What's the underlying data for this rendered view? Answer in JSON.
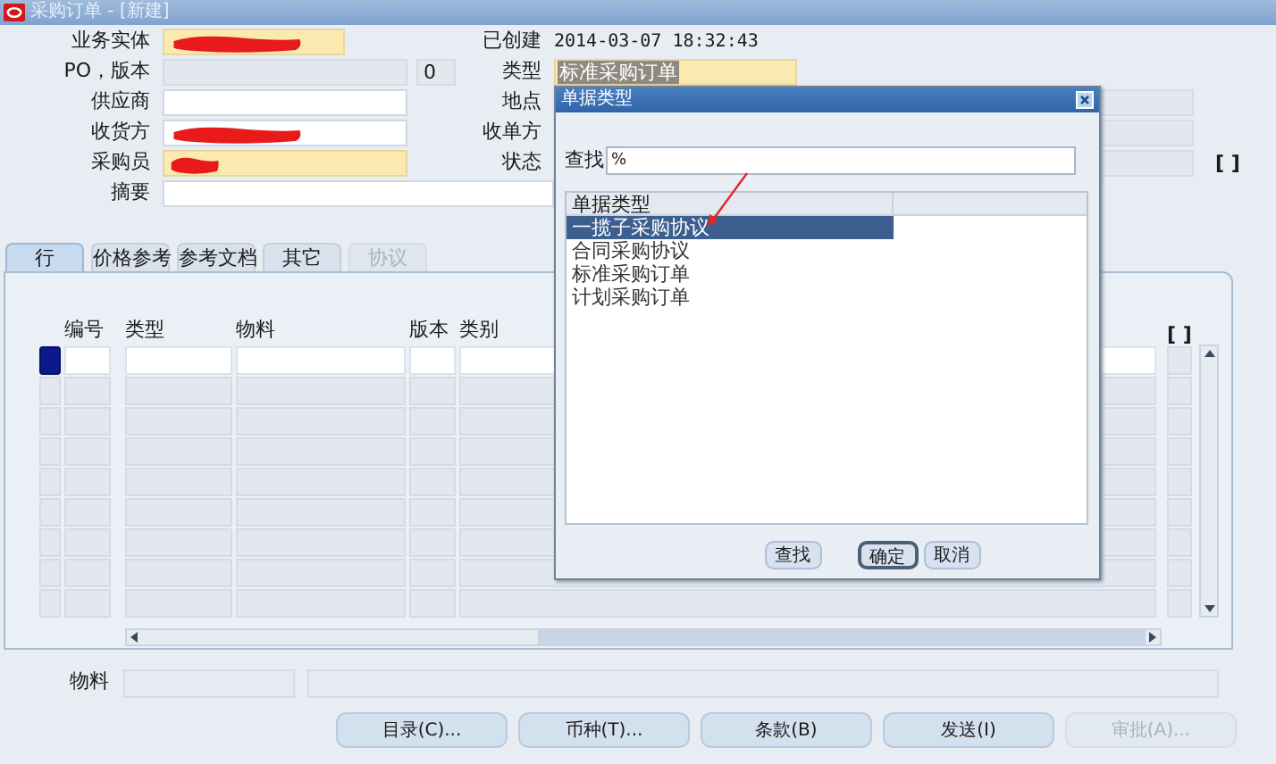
{
  "window": {
    "title": "采购订单 - [新建]"
  },
  "left_fields": [
    {
      "label": "业务实体",
      "required": true,
      "redacted": true,
      "readonly": false
    },
    {
      "label": "PO，版本",
      "required": false,
      "redacted": false,
      "readonly": true,
      "extra_value": "0"
    },
    {
      "label": "供应商",
      "required": false,
      "redacted": false,
      "readonly": false
    },
    {
      "label": "收货方",
      "required": false,
      "redacted": true,
      "readonly": false
    },
    {
      "label": "采购员",
      "required": true,
      "redacted": true,
      "readonly": false
    },
    {
      "label": "摘要",
      "required": false,
      "redacted": false,
      "readonly": false
    }
  ],
  "right_fields": [
    {
      "label": "已创建",
      "kind": "text",
      "value": "2014-03-07 18:32:43"
    },
    {
      "label": "类型",
      "kind": "field",
      "value": "标准采购订单",
      "required": true
    },
    {
      "label": "地点",
      "kind": "field",
      "required": false
    },
    {
      "label": "收单方",
      "kind": "field",
      "required": false
    },
    {
      "label": "状态",
      "kind": "field",
      "required": false,
      "marker": "[ ]"
    }
  ],
  "tabs": [
    {
      "label": "行",
      "selected": true,
      "disabled": false
    },
    {
      "label": "价格参考",
      "selected": false,
      "disabled": false
    },
    {
      "label": "参考文档",
      "selected": false,
      "disabled": false
    },
    {
      "label": "其它",
      "selected": false,
      "disabled": false
    },
    {
      "label": "协议",
      "selected": false,
      "disabled": true
    }
  ],
  "lines": {
    "columns": [
      "编号",
      "类型",
      "物料",
      "版本",
      "类别"
    ],
    "marker": "[ ]",
    "rows": [
      {
        "current": true
      },
      {
        "current": false
      },
      {
        "current": false
      },
      {
        "current": false
      },
      {
        "current": false
      },
      {
        "current": false
      },
      {
        "current": false
      },
      {
        "current": false
      },
      {
        "current": false
      }
    ]
  },
  "item_label": "物料",
  "buttons": [
    {
      "label": "目录(C)...",
      "disabled": false
    },
    {
      "label": "币种(T)...",
      "disabled": false
    },
    {
      "label": "条款(B)",
      "disabled": false
    },
    {
      "label": "发送(I)",
      "disabled": false
    },
    {
      "label": "审批(A)...",
      "disabled": true
    }
  ],
  "dialog": {
    "title": "单据类型",
    "search_label": "查找",
    "search_value": "%",
    "list_header": "单据类型",
    "items": [
      {
        "label": "一揽子采购协议",
        "selected": true
      },
      {
        "label": "合同采购协议",
        "selected": false
      },
      {
        "label": "标准采购订单",
        "selected": false
      },
      {
        "label": "计划采购订单",
        "selected": false
      }
    ],
    "buttons": [
      {
        "label": "查找",
        "default": false
      },
      {
        "label": "确定",
        "default": true
      },
      {
        "label": "取消",
        "default": false
      }
    ]
  }
}
